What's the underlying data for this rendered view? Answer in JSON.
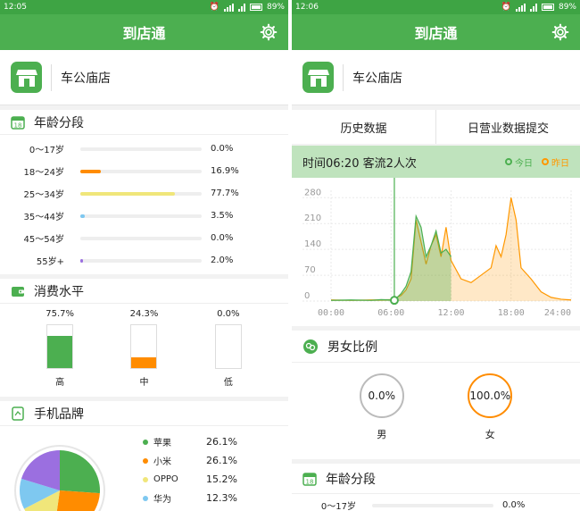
{
  "left": {
    "status": {
      "time": "12:05",
      "battery": "89%"
    },
    "title": "到店通",
    "store": {
      "name": "车公庙店"
    },
    "age": {
      "title": "年龄分段",
      "rows": [
        {
          "label": "0～17岁",
          "value": "0.0%",
          "pct": 0.0,
          "color": "#4caf50"
        },
        {
          "label": "18～24岁",
          "value": "16.9%",
          "pct": 16.9,
          "color": "#ff8c00"
        },
        {
          "label": "25～34岁",
          "value": "77.7%",
          "pct": 77.7,
          "color": "#f0e67a"
        },
        {
          "label": "35～44岁",
          "value": "3.5%",
          "pct": 3.5,
          "color": "#7ec8f0"
        },
        {
          "label": "45～54岁",
          "value": "0.0%",
          "pct": 0.0,
          "color": "#4caf50"
        },
        {
          "label": "55岁+",
          "value": "2.0%",
          "pct": 2.0,
          "color": "#9b6fe0"
        }
      ]
    },
    "consumption": {
      "title": "消费水平",
      "cols": [
        {
          "label": "高",
          "value": "75.7%",
          "pct": 75.7,
          "color": "#4caf50"
        },
        {
          "label": "中",
          "value": "24.3%",
          "pct": 24.3,
          "color": "#ff8c00"
        },
        {
          "label": "低",
          "value": "0.0%",
          "pct": 0.0,
          "color": "#cccccc"
        }
      ]
    },
    "brand": {
      "title": "手机品牌",
      "items": [
        {
          "name": "苹果",
          "value": "26.1%",
          "pct": 26.1,
          "color": "#4caf50"
        },
        {
          "name": "小米",
          "value": "26.1%",
          "pct": 26.1,
          "color": "#ff8c00"
        },
        {
          "name": "OPPO",
          "value": "15.2%",
          "pct": 15.2,
          "color": "#f0e67a"
        },
        {
          "name": "华为",
          "value": "12.3%",
          "pct": 12.3,
          "color": "#7ec8f0"
        }
      ]
    }
  },
  "right": {
    "status": {
      "time": "12:06",
      "battery": "89%"
    },
    "title": "到店通",
    "store": {
      "name": "车公庙店"
    },
    "tabs": [
      "历史数据",
      "日营业数据提交"
    ],
    "flow": {
      "label": "时间06:20   客流2人次",
      "today": "今日",
      "yesterday": "昨日",
      "today_color": "#4caf50",
      "yesterday_color": "#ff9800"
    },
    "gender": {
      "title": "男女比例",
      "male": {
        "label": "男",
        "value": "0.0%"
      },
      "female": {
        "label": "女",
        "value": "100.0%"
      }
    },
    "age": {
      "title": "年龄分段",
      "first_label": "0～17岁",
      "first_value": "0.0%"
    }
  },
  "chart_data": {
    "type": "line",
    "yticks": [
      "280",
      "210",
      "140",
      "70",
      "0"
    ],
    "xticks": [
      "00:00",
      "06:00",
      "12:00",
      "18:00",
      "24:00"
    ],
    "ylim": [
      0,
      300
    ],
    "xlim": [
      0,
      24
    ],
    "series": [
      {
        "name": "今日",
        "x": [
          0,
          2,
          4,
          5,
          6,
          6.3,
          7,
          7.5,
          8,
          8.5,
          9,
          9.5,
          10,
          10.5,
          11,
          11.5,
          12
        ],
        "y": [
          2,
          3,
          2,
          4,
          3,
          2,
          20,
          40,
          80,
          230,
          200,
          120,
          150,
          190,
          130,
          140,
          120
        ]
      },
      {
        "name": "昨日",
        "x": [
          0,
          2,
          4,
          5,
          6,
          7,
          7.5,
          8,
          8.5,
          9,
          9.5,
          10,
          10.5,
          11,
          11.5,
          12,
          13,
          14,
          15,
          16,
          16.5,
          17,
          17.5,
          18,
          18.5,
          19,
          20,
          21,
          22,
          23,
          24
        ],
        "y": [
          3,
          2,
          3,
          3,
          4,
          15,
          30,
          60,
          220,
          160,
          100,
          150,
          180,
          120,
          200,
          110,
          60,
          50,
          70,
          90,
          150,
          120,
          180,
          280,
          220,
          90,
          60,
          25,
          10,
          5,
          3
        ]
      }
    ],
    "selected": {
      "x": 6.33,
      "y": 2
    }
  }
}
